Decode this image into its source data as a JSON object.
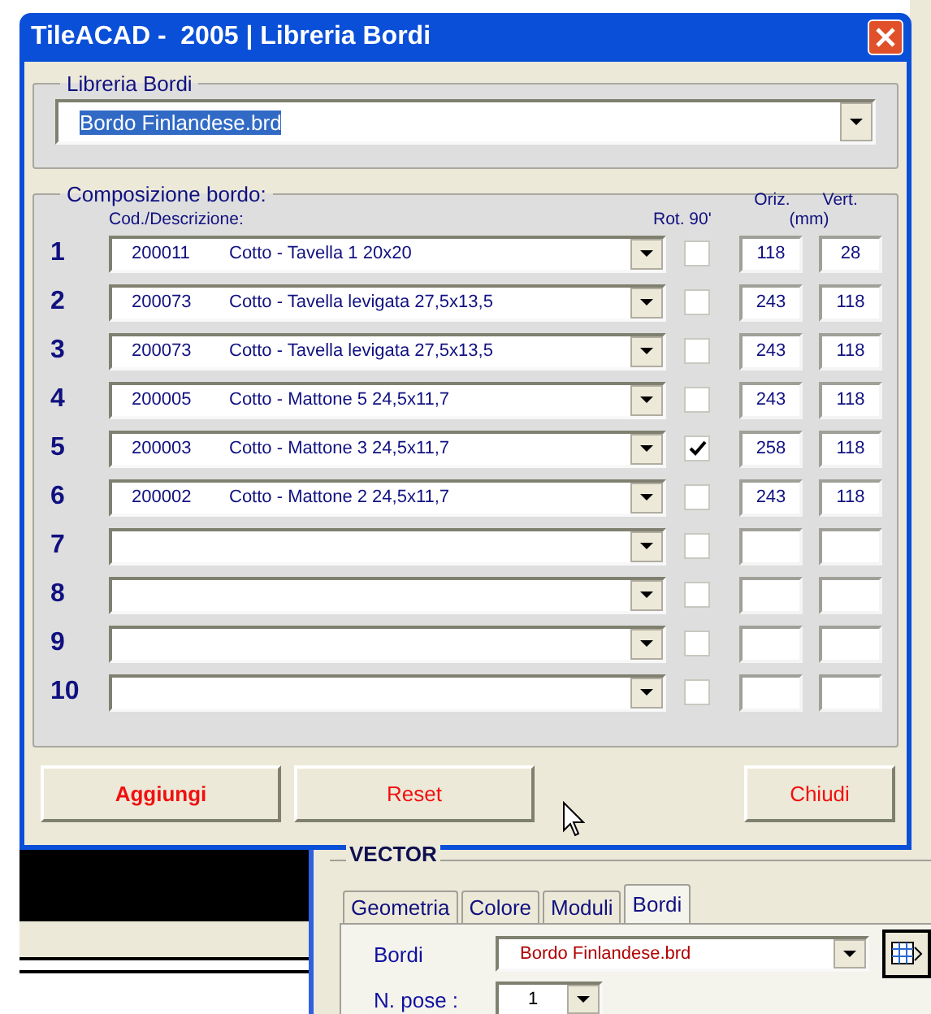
{
  "window": {
    "title": "TileACAD -  2005 | Libreria Bordi"
  },
  "library_group": {
    "title": "Libreria Bordi",
    "value": "Bordo Finlandese.brd"
  },
  "composition_group": {
    "title": "Composizione bordo:",
    "column_headers": {
      "description": "Cod./Descrizione:",
      "rotation": "Rot. 90'",
      "horizontal": "Oriz.",
      "unit": "(mm)",
      "vertical": "Vert."
    },
    "rows": [
      {
        "number": "1",
        "code": "200011",
        "description": "Cotto - Tavella 1 20x20",
        "rotated": false,
        "horizontal": "118",
        "vertical": "28"
      },
      {
        "number": "2",
        "code": "200073",
        "description": "Cotto - Tavella levigata 27,5x13,5",
        "rotated": false,
        "horizontal": "243",
        "vertical": "118"
      },
      {
        "number": "3",
        "code": "200073",
        "description": "Cotto - Tavella levigata 27,5x13,5",
        "rotated": false,
        "horizontal": "243",
        "vertical": "118"
      },
      {
        "number": "4",
        "code": "200005",
        "description": "Cotto - Mattone 5 24,5x11,7",
        "rotated": false,
        "horizontal": "243",
        "vertical": "118"
      },
      {
        "number": "5",
        "code": "200003",
        "description": "Cotto - Mattone 3 24,5x11,7",
        "rotated": true,
        "horizontal": "258",
        "vertical": "118"
      },
      {
        "number": "6",
        "code": "200002",
        "description": "Cotto - Mattone 2 24,5x11,7",
        "rotated": false,
        "horizontal": "243",
        "vertical": "118"
      },
      {
        "number": "7",
        "rotated": false
      },
      {
        "number": "8",
        "rotated": false
      },
      {
        "number": "9",
        "rotated": false
      },
      {
        "number": "10",
        "rotated": false
      }
    ]
  },
  "buttons": {
    "add": "Aggiungi",
    "reset": "Reset",
    "close": "Chiudi"
  },
  "background_panel": {
    "title": "VECTOR",
    "tabs": [
      {
        "label": "Geometria",
        "selected": false
      },
      {
        "label": "Colore",
        "selected": false
      },
      {
        "label": "Moduli",
        "selected": false
      },
      {
        "label": "Bordi",
        "selected": true
      }
    ],
    "borders_label": "Bordi",
    "borders_value": "Bordo Finlandese.brd",
    "count_label": "N. pose :",
    "count_value": "1"
  }
}
